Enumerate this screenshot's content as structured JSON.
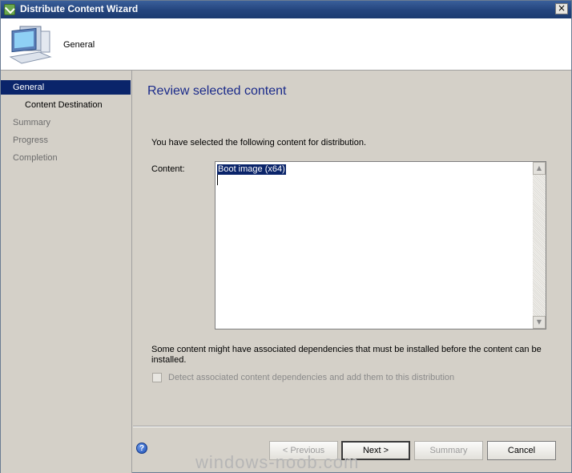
{
  "window": {
    "title": "Distribute Content Wizard",
    "close_glyph": "×"
  },
  "header": {
    "title": "General",
    "icon": "computer-icon"
  },
  "sidebar": {
    "items": [
      {
        "label": "General"
      },
      {
        "label": "Content Destination"
      },
      {
        "label": "Summary"
      },
      {
        "label": "Progress"
      },
      {
        "label": "Completion"
      }
    ]
  },
  "main": {
    "title": "Review selected content",
    "intro": "You have selected the following content for distribution.",
    "content_label": "Content:",
    "content_items": [
      "Boot image (x64)"
    ],
    "scroll_up": "▲",
    "scroll_down": "▼",
    "dependencies_note": "Some content might have associated dependencies that must be installed before the content can be installed.",
    "dependencies_checkbox": {
      "label": "Detect associated content dependencies and add them to this distribution",
      "checked": false,
      "enabled": false
    }
  },
  "footer": {
    "help_glyph": "?",
    "previous": "< Previous",
    "next": "Next >",
    "summary": "Summary",
    "cancel": "Cancel"
  },
  "watermark": "windows-noob.com",
  "colors": {
    "selection": "#0a246a",
    "title_text": "#1a2a8a",
    "titlebar": "#25467f"
  }
}
